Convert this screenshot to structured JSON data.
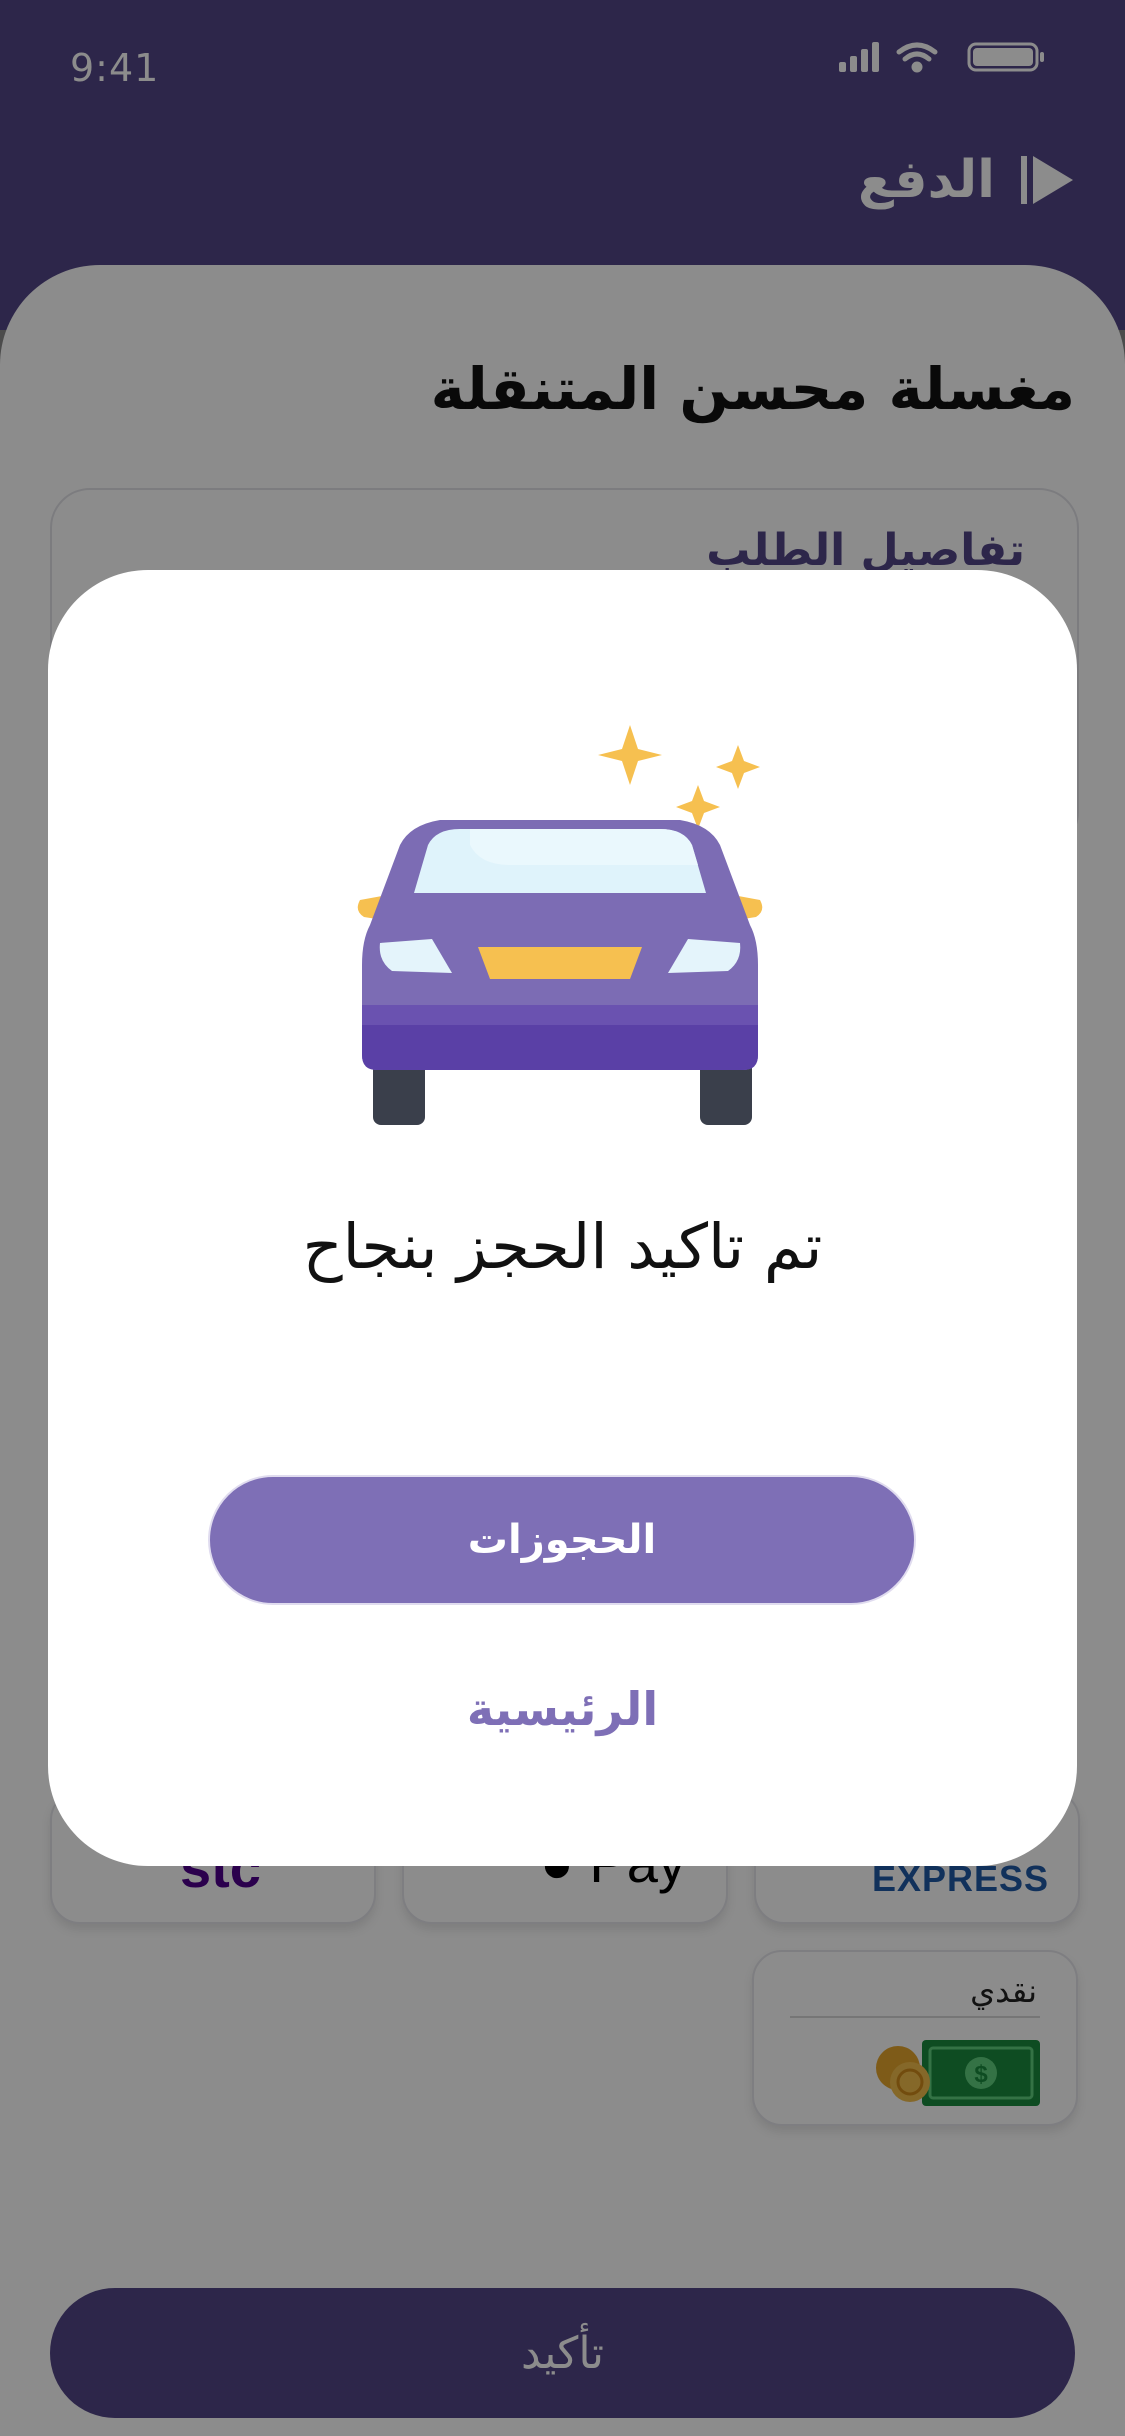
{
  "status_bar": {
    "time": "9:41"
  },
  "header": {
    "title": "الدفع",
    "back_icon": "play-back-icon"
  },
  "shop": {
    "title": "مغسلة محسن المتنقلة"
  },
  "order_card": {
    "title": "تفاصيل الطلب"
  },
  "payment_methods": {
    "stc": "stc",
    "apple_pay": "Pay",
    "amex": "EXPRESS",
    "cash": "نقدي"
  },
  "confirm_button": {
    "label": "تأكيد"
  },
  "modal": {
    "illustration": "car-icon",
    "title": "تم تاكيد الحجز بنجاح",
    "bookings_button": "الحجوزات",
    "home_link": "الرئيسية"
  },
  "colors": {
    "primary": "#524587",
    "accent": "#7e6fb6",
    "star": "#f6c050"
  }
}
